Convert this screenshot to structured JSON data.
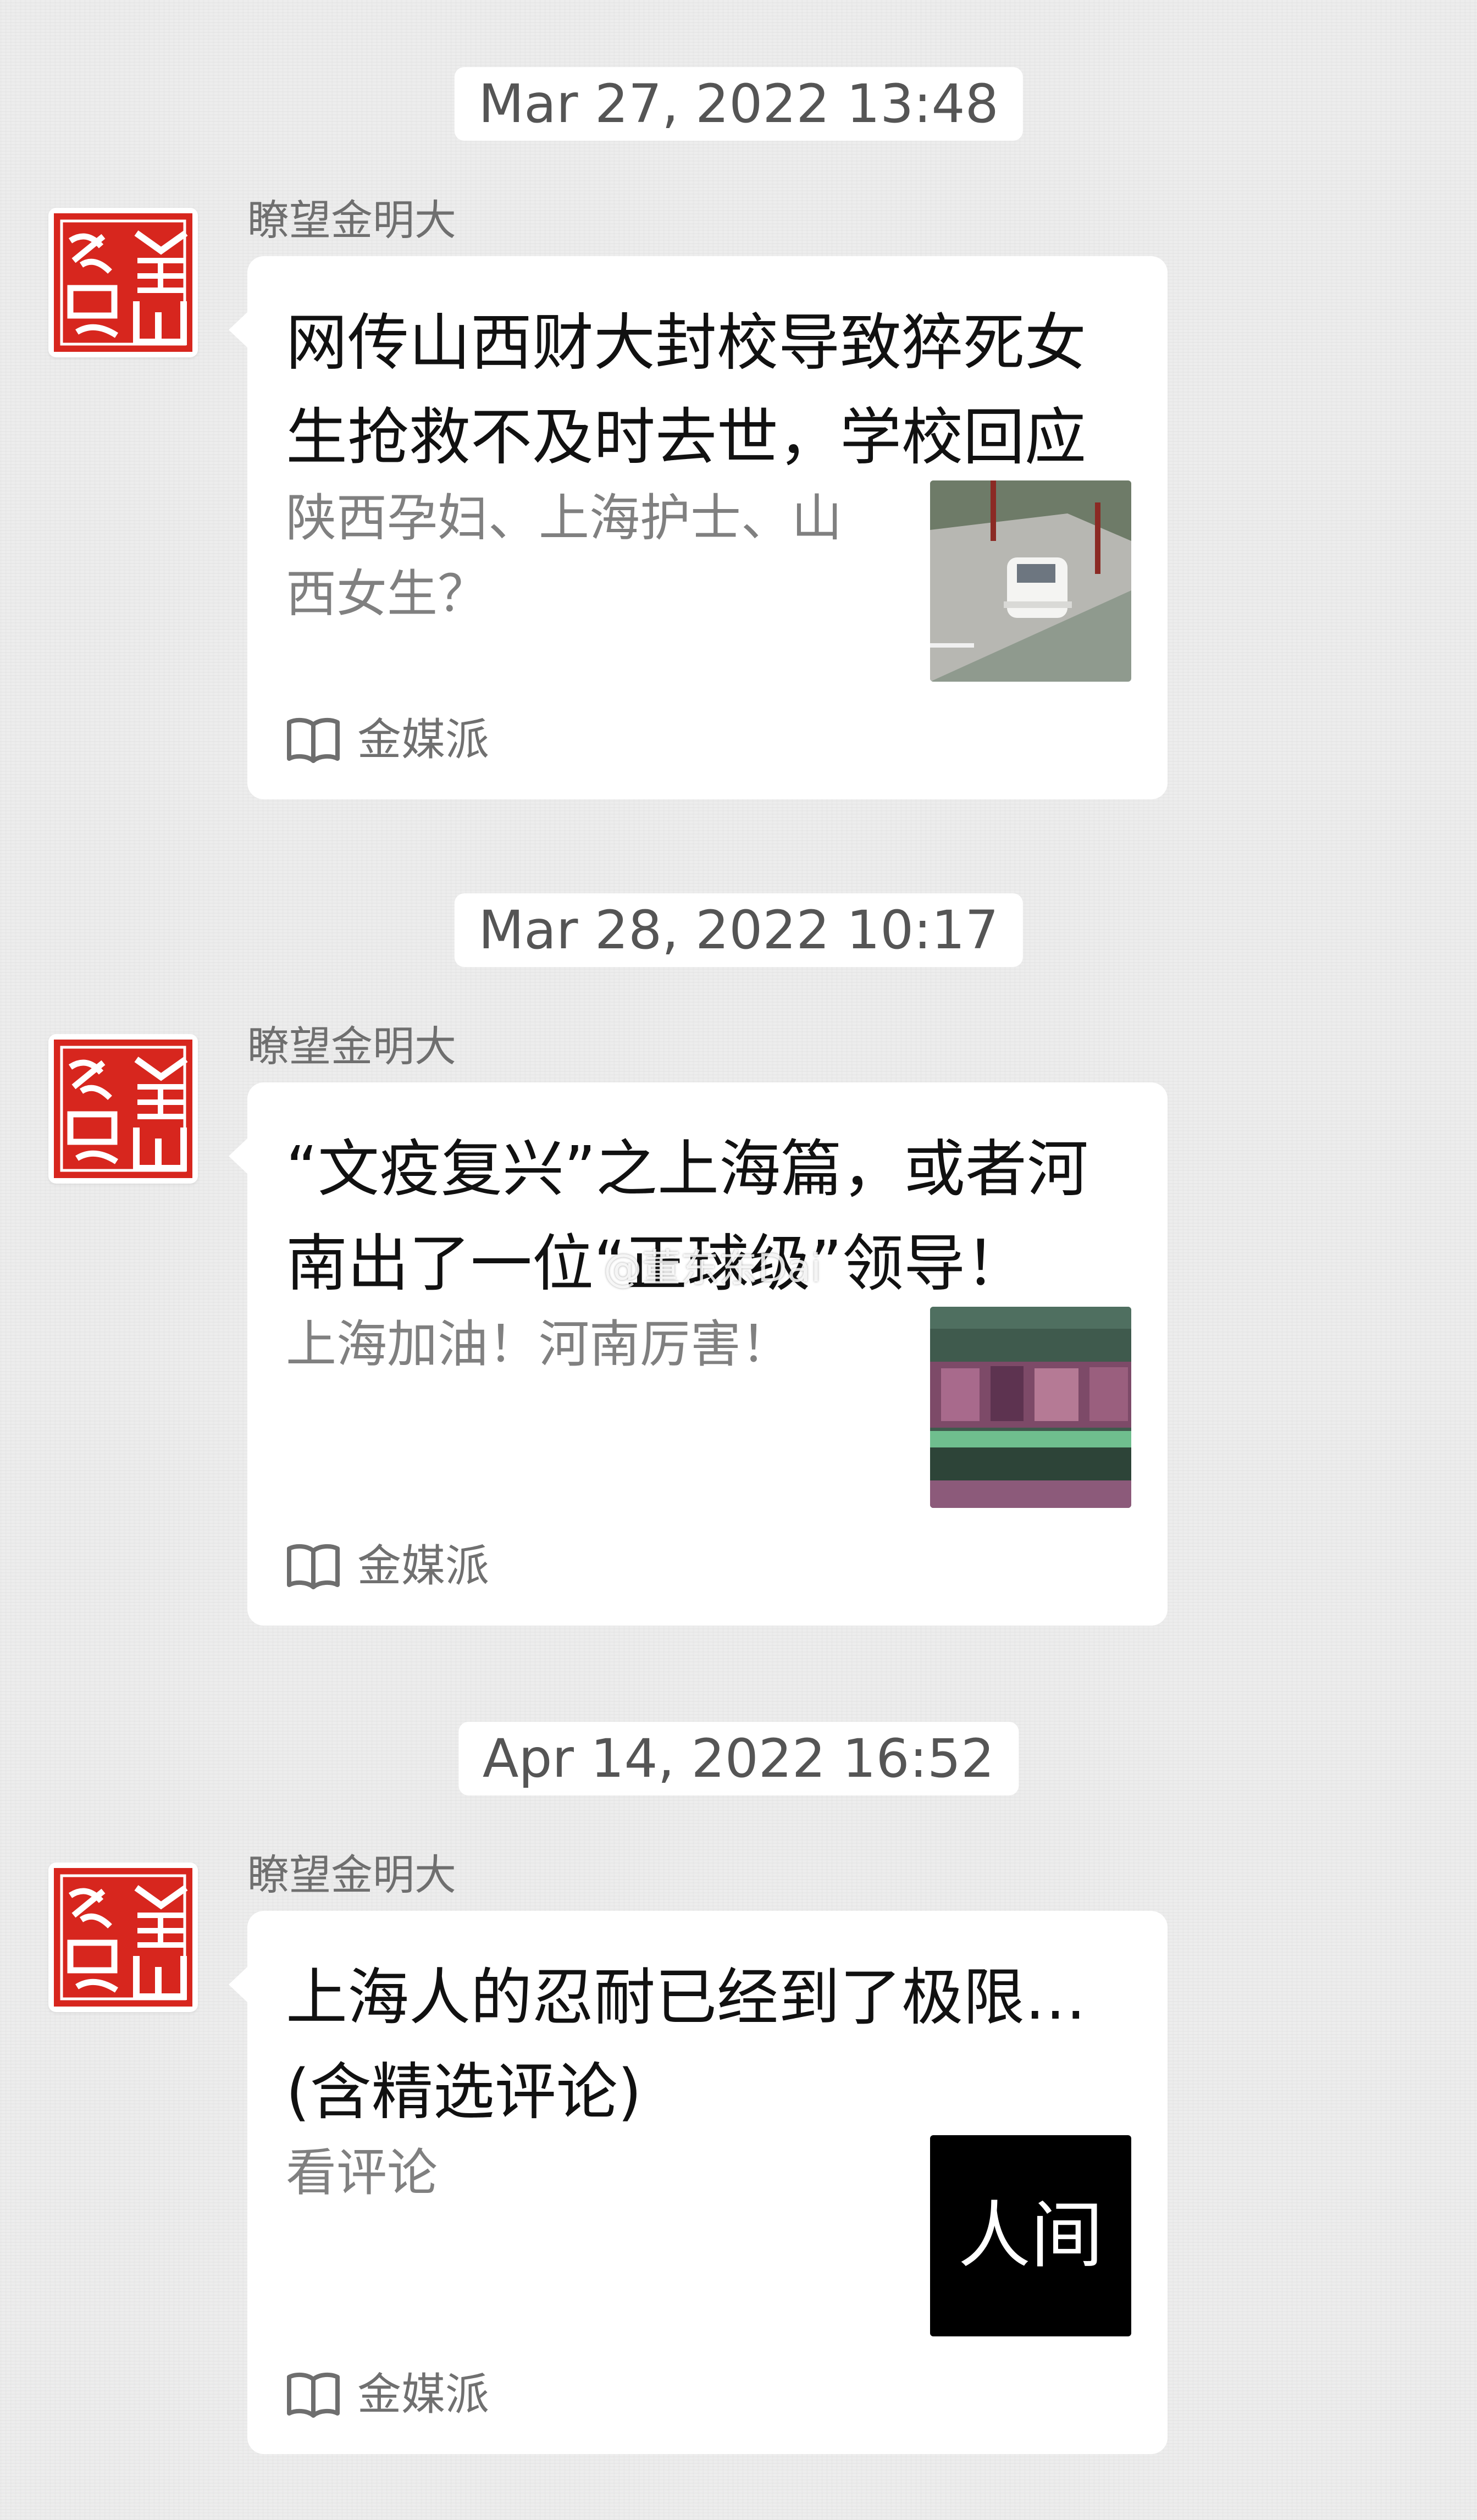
{
  "messages": [
    {
      "timestamp": "Mar 27, 2022 13:48",
      "sender": "瞭望金明大",
      "avatar_icon": "red-seal-logo-icon",
      "title": "网传山西财大封校导致猝死女生抢救不及时去世，学校回应",
      "description": "陕西孕妇、上海护士、山西女生？",
      "thumbnail": "ambulance-photo-thumbnail",
      "source_icon": "book-open-icon",
      "source": "金媒派"
    },
    {
      "timestamp": "Mar 28, 2022 10:17",
      "sender": "瞭望金明大",
      "avatar_icon": "red-seal-logo-icon",
      "title": "“文疫复兴”之上海篇，或者河南出了一位“正球级”领导！",
      "description": "上海加油！河南厉害！",
      "thumbnail": "store-shelf-photo-thumbnail",
      "source_icon": "book-open-icon",
      "source": "金媒派"
    },
    {
      "timestamp": "Apr 14, 2022 16:52",
      "sender": "瞭望金明大",
      "avatar_icon": "red-seal-logo-icon",
      "title": "上海人的忍耐已经到了极限…(含精选评论)",
      "description": "看评论",
      "thumbnail": "renjian-text-thumbnail",
      "thumbnail_text": "人间",
      "source_icon": "book-open-icon",
      "source": "金媒派"
    }
  ],
  "watermark": "@董东东Dai",
  "colors": {
    "background": "#ededed",
    "card": "#ffffff",
    "seal_red": "#d7261e"
  }
}
